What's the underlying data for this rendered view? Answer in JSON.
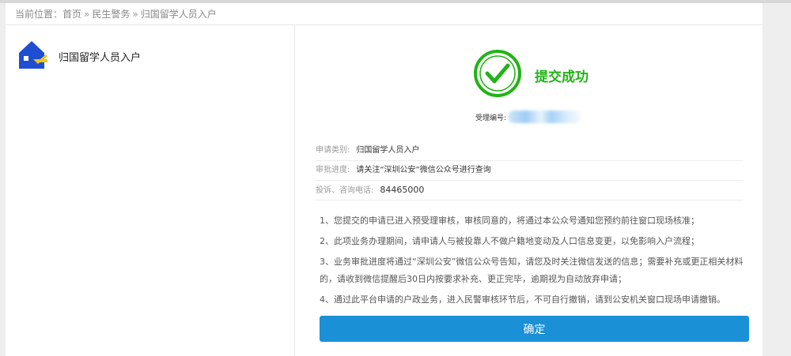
{
  "breadcrumb": {
    "prefix": "当前位置：",
    "items": [
      "首页",
      "民生警务",
      "归国留学人员入户"
    ],
    "separator": "»"
  },
  "service": {
    "icon": "house-blue-icon",
    "label": "归国留学人员入户"
  },
  "result": {
    "icon": "check-circle-icon",
    "title": "提交成功",
    "accept_no_label": "受理编号:"
  },
  "info": {
    "category_label": "申请类别:",
    "category_value": "归国留学人员入户",
    "progress_label": "审批进度:",
    "progress_value": "请关注“深圳公安”微信公众号进行查询",
    "phone_label": "投诉、咨询电话:",
    "phone_value": "84465000"
  },
  "notes": [
    "1、您提交的申请已进入预受理审核，审核同意的，将通过本公众号通知您预约前往窗口现场核准；",
    "2、此项业务办理期间，请申请人与被投靠人不做户籍地变动及人口信息变更，以免影响入户流程；",
    "3、业务审批进度将通过“深圳公安”微信公众号告知，请您及时关注微信发送的信息；需要补充或更正相关材料的，请收到微信提醒后30日内按要求补充、更正完毕，逾期视为自动放弃申请；",
    "4、通过此平台申请的户政业务，进入民警审核环节后，不可自行撤销，请到公安机关窗口现场申请撤销。"
  ],
  "confirm_label": "确定",
  "colors": {
    "accent_blue": "#1a90d6",
    "success_green": "#22b316"
  }
}
